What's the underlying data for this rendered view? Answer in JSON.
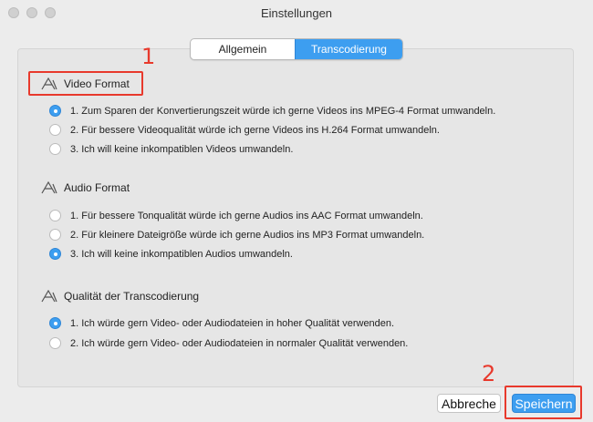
{
  "window": {
    "title": "Einstellungen"
  },
  "tabs": [
    {
      "label": "Allgemein",
      "active": false
    },
    {
      "label": "Transcodierung",
      "active": true
    }
  ],
  "sections": [
    {
      "title": "Video Format",
      "options": [
        {
          "label": "1. Zum Sparen der Konvertierungszeit würde ich gerne Videos ins MPEG-4 Format umwandeln.",
          "selected": true
        },
        {
          "label": "2. Für bessere Videoqualität würde ich gerne Videos ins H.264 Format umwandeln.",
          "selected": false
        },
        {
          "label": "3. Ich will keine inkompatiblen Videos umwandeln.",
          "selected": false
        }
      ]
    },
    {
      "title": "Audio Format",
      "options": [
        {
          "label": "1. Für bessere Tonqualität würde ich gerne Audios ins AAC Format umwandeln.",
          "selected": false
        },
        {
          "label": "2. Für kleinere Dateigröße würde ich gerne Audios ins MP3 Format umwandeln.",
          "selected": false
        },
        {
          "label": "3. Ich will keine inkompatiblen Audios umwandeln.",
          "selected": true
        }
      ]
    },
    {
      "title": "Qualität der Transcodierung",
      "options": [
        {
          "label": "1. Ich würde gern Video- oder Audiodateien in hoher Qualität verwenden.",
          "selected": true
        },
        {
          "label": "2. Ich würde gern Video- oder Audiodateien in normaler Qualität verwenden.",
          "selected": false
        }
      ]
    }
  ],
  "annotations": {
    "marker_1": "1",
    "marker_2": "2"
  },
  "footer": {
    "cancel_label": "Abbreche",
    "save_label": "Speichern"
  },
  "colors": {
    "accent": "#3d9ef0",
    "annotation_red": "#e8392c",
    "background": "#ececec"
  },
  "icons": {
    "section_icon": "app-store-a-icon"
  }
}
